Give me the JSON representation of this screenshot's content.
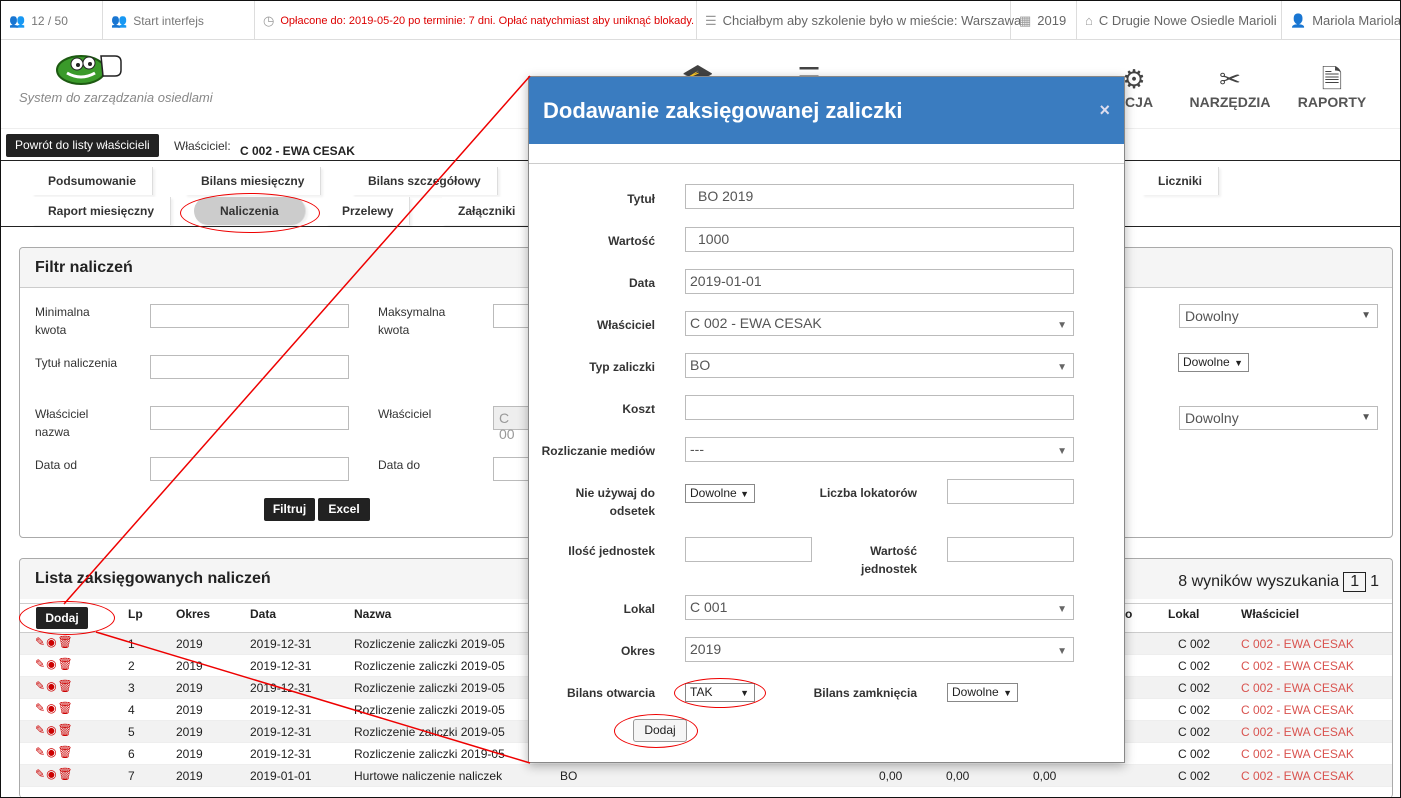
{
  "topbar": {
    "users_count": "12 / 50",
    "start_interface": "Start interfejs",
    "payment_notice": "Opłacone do: 2019-05-20 po terminie: 7 dni. Opłać natychmiast aby uniknąć blokady.",
    "training_city": "Chciałbym aby szkolenie było w mieście: Warszawa",
    "year": "2019",
    "estate": "C Drugie Nowe Osiedle Marioli",
    "user": "Mariola Mariola"
  },
  "header": {
    "logo_text": "System do zarządzania osiedlami",
    "nav_partial": "ACJA",
    "nav_tools": "NARZĘDZIA",
    "nav_reports": "RAPORTY"
  },
  "owner_bar": {
    "back_label": "Powrót do listy właścicieli",
    "owner_label": "Właściciel:",
    "owner_value": "C 002 - EWA CESAK"
  },
  "tabs": {
    "summary": "Podsumowanie",
    "monthly_balance": "Bilans miesięczny",
    "detailed_balance": "Bilans szczegółowy",
    "meters": "Liczniki",
    "monthly_report": "Raport miesięczny",
    "charges": "Naliczenia",
    "transfers": "Przelewy",
    "attachments": "Załączniki"
  },
  "filter": {
    "title": "Filtr naliczeń",
    "min_amount_l1": "Minimalna",
    "min_amount_l2": "kwota",
    "max_amount_l1": "Maksymalna",
    "max_amount_l2": "kwota",
    "charge_title": "Tytuł naliczenia",
    "owner_name_l1": "Właściciel",
    "owner_name_l2": "nazwa",
    "owner": "Właściciel",
    "owner_select_partial": "C 00",
    "date_from": "Data od",
    "date_to": "Data do",
    "select_any_1": "Dowolny",
    "select_any_small": "Dowolne",
    "select_any_2": "Dowolny",
    "filter_btn": "Filtruj",
    "excel_btn": "Excel"
  },
  "list": {
    "title": "Lista zaksięgowanych naliczeń",
    "results": "8 wyników wyszukania",
    "page": "1",
    "last_page": "1",
    "add_btn": "Dodaj",
    "partial_header": "o",
    "columns": {
      "lp": "Lp",
      "period": "Okres",
      "date": "Data",
      "name": "Nazwa",
      "unit": "Lokal",
      "owner": "Właściciel"
    },
    "rows": [
      {
        "lp": "1",
        "period": "2019",
        "date": "2019-12-31",
        "name": "Rozliczenie zaliczki 2019-05",
        "unit": "C 002",
        "owner": "C 002 - EWA CESAK"
      },
      {
        "lp": "2",
        "period": "2019",
        "date": "2019-12-31",
        "name": "Rozliczenie zaliczki 2019-05",
        "unit": "C 002",
        "owner": "C 002 - EWA CESAK"
      },
      {
        "lp": "3",
        "period": "2019",
        "date": "2019-12-31",
        "name": "Rozliczenie zaliczki 2019-05",
        "unit": "C 002",
        "owner": "C 002 - EWA CESAK"
      },
      {
        "lp": "4",
        "period": "2019",
        "date": "2019-12-31",
        "name": "Rozliczenie zaliczki 2019-05",
        "unit": "C 002",
        "owner": "C 002 - EWA CESAK"
      },
      {
        "lp": "5",
        "period": "2019",
        "date": "2019-12-31",
        "name": "Rozliczenie zaliczki 2019-05",
        "unit": "C 002",
        "owner": "C 002 - EWA CESAK"
      },
      {
        "lp": "6",
        "period": "2019",
        "date": "2019-12-31",
        "name": "Rozliczenie zaliczki 2019-05",
        "unit": "C 002",
        "owner": "C 002 - EWA CESAK"
      },
      {
        "lp": "7",
        "period": "2019",
        "date": "2019-01-01",
        "name": "Hurtowe naliczenie naliczek",
        "type": "BO",
        "v1": "0,00",
        "v2": "0,00",
        "v3": "0,00",
        "unit": "C 002",
        "owner": "C 002 - EWA CESAK"
      }
    ]
  },
  "modal": {
    "title": "Dodawanie zaksięgowanej zaliczki",
    "close": "×",
    "title_label": "Tytuł",
    "title_value": "BO 2019",
    "value_label": "Wartość",
    "value_value": "1000",
    "date_label": "Data",
    "date_value": "2019-01-01",
    "owner_label": "Właściciel",
    "owner_value": "C 002 - EWA CESAK",
    "type_label": "Typ zaliczki",
    "type_value": "BO",
    "cost_label": "Koszt",
    "media_label": "Rozliczanie mediów",
    "media_value": "---",
    "no_interest_l1": "Nie używaj do",
    "no_interest_l2": "odsetek",
    "no_interest_value": "Dowolne",
    "tenants_label": "Liczba lokatorów",
    "units_label": "Ilość jednostek",
    "unit_value_l1": "Wartość",
    "unit_value_l2": "jednostek",
    "unit_label": "Lokal",
    "unit_value": "C 001",
    "period_label": "Okres",
    "period_value": "2019",
    "opening_label": "Bilans otwarcia",
    "opening_value": "TAK",
    "closing_label": "Bilans zamknięcia",
    "closing_value": "Dowolne",
    "add_btn": "Dodaj"
  },
  "colors": {
    "modal_header": "#3a7cc0",
    "annotation": "#e00000",
    "owner_link": "#d9534f",
    "payment_notice": "#dd0000"
  },
  "icons": [
    "users-icon",
    "clock-icon",
    "list-icon",
    "calendar-icon",
    "home-icon",
    "user-icon",
    "scissors-icon",
    "pdf-icon",
    "pencil-icon",
    "eye-icon",
    "trash-icon"
  ]
}
